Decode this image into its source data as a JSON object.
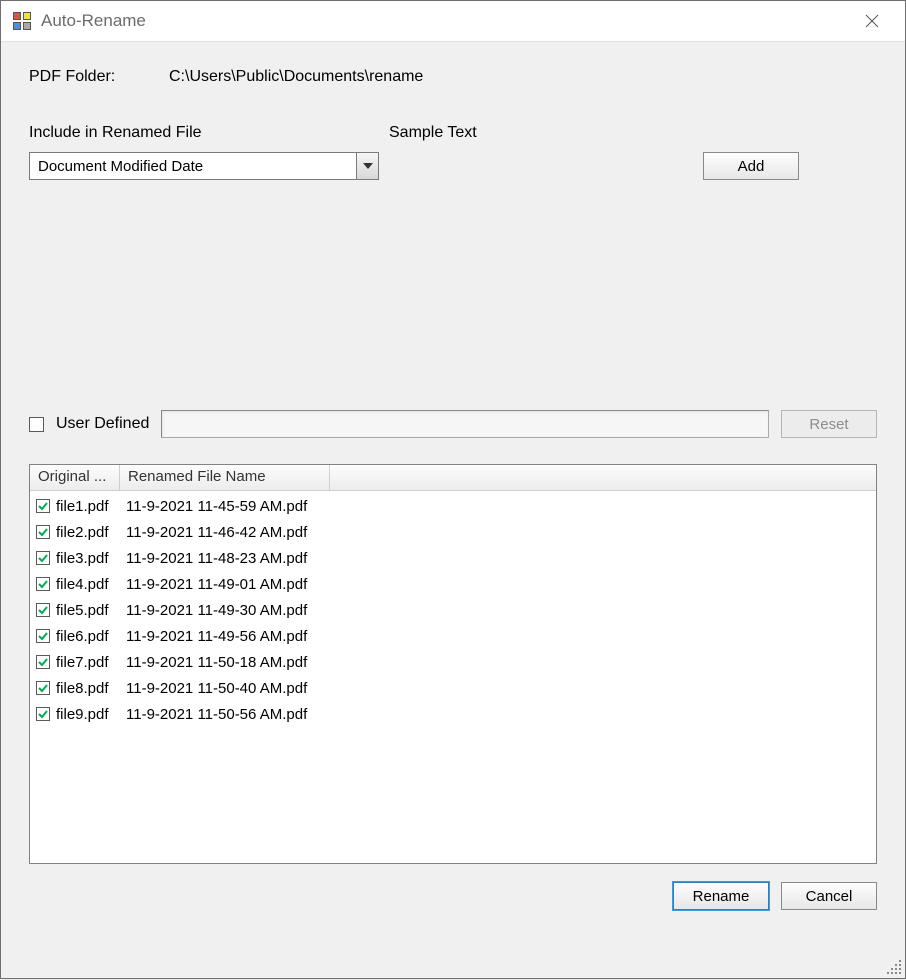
{
  "window": {
    "title": "Auto-Rename"
  },
  "folder": {
    "label": "PDF Folder:",
    "path": "C:\\Users\\Public\\Documents\\rename"
  },
  "include": {
    "label": "Include in Renamed File",
    "sample_label": "Sample Text",
    "selected": "Document Modified Date",
    "add_label": "Add"
  },
  "userdef": {
    "label": "User Defined",
    "checked": false,
    "value": "",
    "reset_label": "Reset"
  },
  "list": {
    "col_original": "Original ...",
    "col_renamed": "Renamed File Name",
    "rows": [
      {
        "checked": true,
        "original": "file1.pdf",
        "renamed": "11-9-2021 11-45-59 AM.pdf"
      },
      {
        "checked": true,
        "original": "file2.pdf",
        "renamed": "11-9-2021 11-46-42 AM.pdf"
      },
      {
        "checked": true,
        "original": "file3.pdf",
        "renamed": "11-9-2021 11-48-23 AM.pdf"
      },
      {
        "checked": true,
        "original": "file4.pdf",
        "renamed": "11-9-2021 11-49-01 AM.pdf"
      },
      {
        "checked": true,
        "original": "file5.pdf",
        "renamed": "11-9-2021 11-49-30 AM.pdf"
      },
      {
        "checked": true,
        "original": "file6.pdf",
        "renamed": "11-9-2021 11-49-56 AM.pdf"
      },
      {
        "checked": true,
        "original": "file7.pdf",
        "renamed": "11-9-2021 11-50-18 AM.pdf"
      },
      {
        "checked": true,
        "original": "file8.pdf",
        "renamed": "11-9-2021 11-50-40 AM.pdf"
      },
      {
        "checked": true,
        "original": "file9.pdf",
        "renamed": "11-9-2021 11-50-56 AM.pdf"
      }
    ]
  },
  "footer": {
    "rename_label": "Rename",
    "cancel_label": "Cancel"
  }
}
